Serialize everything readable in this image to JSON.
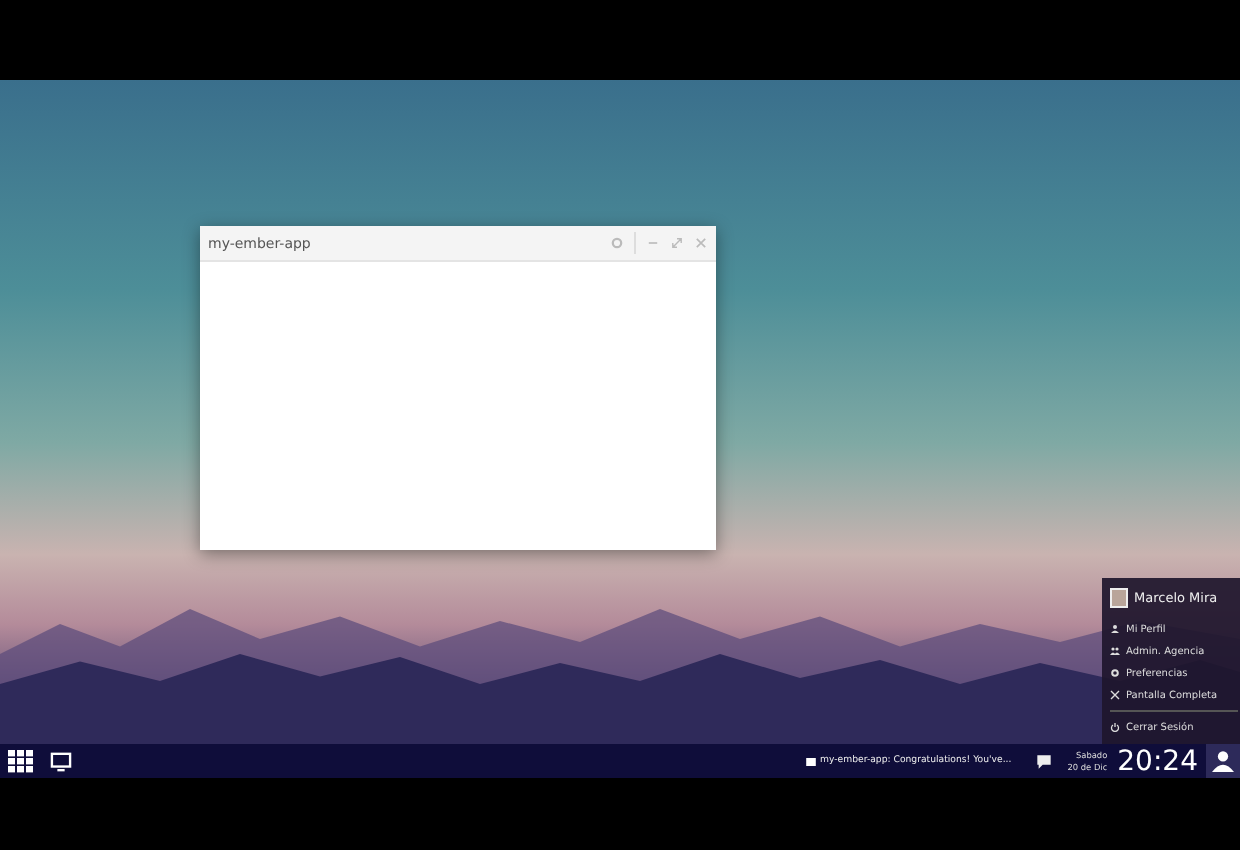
{
  "app_window": {
    "title": "my-ember-app"
  },
  "user_menu": {
    "user_name": "Marcelo Mira",
    "items": [
      {
        "label": "Mi Perfil"
      },
      {
        "label": "Admin. Agencia"
      },
      {
        "label": "Preferencias"
      },
      {
        "label": "Pantalla Completa"
      }
    ],
    "footer_item": {
      "label": "Cerrar Sesión"
    }
  },
  "taskbar": {
    "notification": "my-ember-app: Congratulations! You've...",
    "date_line_1": "Sabado",
    "date_line_2": "20 de Dic",
    "time": "20:24"
  }
}
